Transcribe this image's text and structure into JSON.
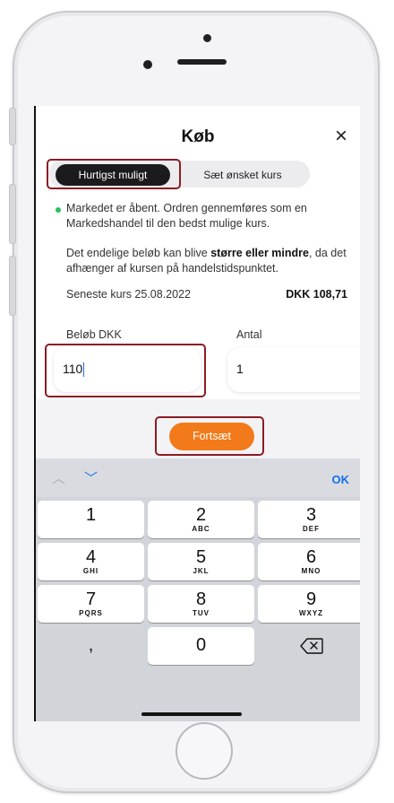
{
  "header": {
    "title": "Køb",
    "close_icon": "close-icon"
  },
  "order_type": {
    "options": [
      "Hurtigst muligt",
      "Sæt ønsket kurs"
    ],
    "selected": "Hurtigst muligt"
  },
  "market_status": {
    "text": "Markedet er åbent. Ordren gennemføres som en Markedshandel til den bedst mulige kurs.",
    "status_color": "#22c55e"
  },
  "notice": {
    "before": "Det endelige beløb kan blive ",
    "bold": "større eller mindre",
    "after": ", da det afhænger af kursen på handelstidspunktet."
  },
  "latest_price": {
    "label": "Seneste kurs 25.08.2022",
    "value": "DKK 108,71"
  },
  "amount": {
    "label": "Beløb DKK",
    "value": "110"
  },
  "quantity": {
    "label": "Antal",
    "value": "1"
  },
  "continue_label": "Fortsæt",
  "keyboard": {
    "ok_label": "OK",
    "keys": [
      {
        "num": "1",
        "letters": ""
      },
      {
        "num": "2",
        "letters": "ABC"
      },
      {
        "num": "3",
        "letters": "DEF"
      },
      {
        "num": "4",
        "letters": "GHI"
      },
      {
        "num": "5",
        "letters": "JKL"
      },
      {
        "num": "6",
        "letters": "MNO"
      },
      {
        "num": "7",
        "letters": "PQRS"
      },
      {
        "num": "8",
        "letters": "TUV"
      },
      {
        "num": "9",
        "letters": "WXYZ"
      },
      {
        "num": ",",
        "letters": ""
      },
      {
        "num": "0",
        "letters": ""
      }
    ]
  },
  "colors": {
    "accent": "#f27a1a",
    "highlight": "#8c1c24",
    "keyboard_blue": "#1570ef"
  }
}
